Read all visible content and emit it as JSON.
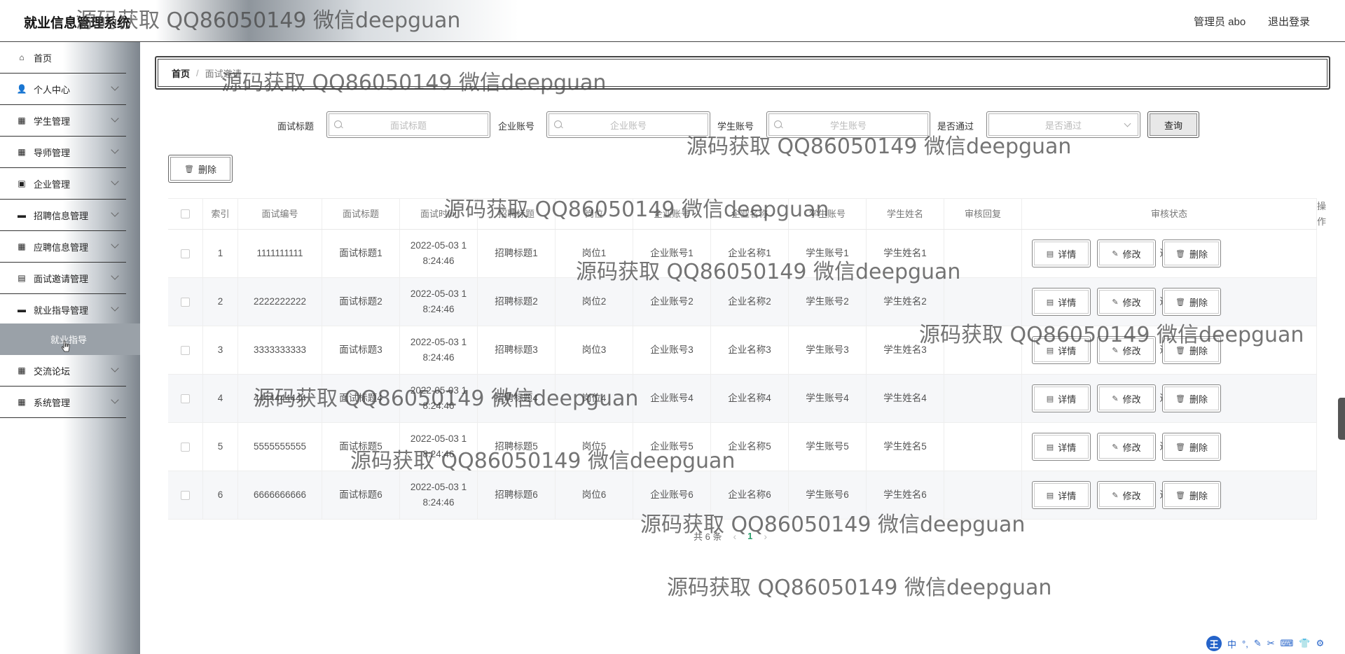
{
  "header": {
    "title": "就业信息管理系统",
    "user": "管理员 abo",
    "logout": "退出登录"
  },
  "sidebar": {
    "items": [
      {
        "label": "首页",
        "icon": "home-icon",
        "expandable": false
      },
      {
        "label": "个人中心",
        "icon": "user-icon",
        "expandable": true
      },
      {
        "label": "学生管理",
        "icon": "grid-icon",
        "expandable": true
      },
      {
        "label": "导师管理",
        "icon": "grid-icon",
        "expandable": true
      },
      {
        "label": "企业管理",
        "icon": "building-icon",
        "expandable": true
      },
      {
        "label": "招聘信息管理",
        "icon": "monitor-icon",
        "expandable": true
      },
      {
        "label": "应聘信息管理",
        "icon": "grid-icon",
        "expandable": true
      },
      {
        "label": "面试邀请管理",
        "icon": "chat-icon",
        "expandable": true
      },
      {
        "label": "就业指导管理",
        "icon": "monitor-icon",
        "expandable": true
      },
      {
        "label": "交流论坛",
        "icon": "grid-icon",
        "expandable": true
      },
      {
        "label": "系统管理",
        "icon": "grid-icon",
        "expandable": true
      }
    ],
    "active_sub": "就业指导"
  },
  "breadcrumb": {
    "home": "首页",
    "current": "面试邀请"
  },
  "search": {
    "title_label": "面试标题",
    "title_placeholder": "面试标题",
    "company_label": "企业账号",
    "company_placeholder": "企业账号",
    "student_label": "学生账号",
    "student_placeholder": "学生账号",
    "passed_label": "是否通过",
    "passed_placeholder": "是否通过",
    "query_button": "查询"
  },
  "toolbar": {
    "delete_button": "删除"
  },
  "table": {
    "columns": [
      "索引",
      "面试编号",
      "面试标题",
      "面试时间",
      "招聘标题",
      "岗位",
      "企业账号",
      "企业名称",
      "学生账号",
      "学生姓名",
      "审核回复",
      "审核状态",
      "操作"
    ],
    "rows": [
      {
        "index": "1",
        "code": "1111111111",
        "title": "面试标题1",
        "time": "2022-05-03 18:24:46",
        "job_title": "招聘标题1",
        "position": "岗位1",
        "company_account": "企业账号1",
        "company_name": "企业名称1",
        "student_account": "学生账号1",
        "student_name": "学生姓名1",
        "reply": "",
        "status": "通过"
      },
      {
        "index": "2",
        "code": "2222222222",
        "title": "面试标题2",
        "time": "2022-05-03 18:24:46",
        "job_title": "招聘标题2",
        "position": "岗位2",
        "company_account": "企业账号2",
        "company_name": "企业名称2",
        "student_account": "学生账号2",
        "student_name": "学生姓名2",
        "reply": "",
        "status": "通过"
      },
      {
        "index": "3",
        "code": "3333333333",
        "title": "面试标题3",
        "time": "2022-05-03 18:24:46",
        "job_title": "招聘标题3",
        "position": "岗位3",
        "company_account": "企业账号3",
        "company_name": "企业名称3",
        "student_account": "学生账号3",
        "student_name": "学生姓名3",
        "reply": "",
        "status": "通过"
      },
      {
        "index": "4",
        "code": "4444444444",
        "title": "面试标题4",
        "time": "2022-05-03 18:24:46",
        "job_title": "招聘标题4",
        "position": "岗位4",
        "company_account": "企业账号4",
        "company_name": "企业名称4",
        "student_account": "学生账号4",
        "student_name": "学生姓名4",
        "reply": "",
        "status": "通过"
      },
      {
        "index": "5",
        "code": "5555555555",
        "title": "面试标题5",
        "time": "2022-05-03 18:24:46",
        "job_title": "招聘标题5",
        "position": "岗位5",
        "company_account": "企业账号5",
        "company_name": "企业名称5",
        "student_account": "学生账号5",
        "student_name": "学生姓名5",
        "reply": "",
        "status": "通过"
      },
      {
        "index": "6",
        "code": "6666666666",
        "title": "面试标题6",
        "time": "2022-05-03 18:24:46",
        "job_title": "招聘标题6",
        "position": "岗位6",
        "company_account": "企业账号6",
        "company_name": "企业名称6",
        "student_account": "学生账号6",
        "student_name": "学生姓名6",
        "reply": "",
        "status": "通过"
      }
    ],
    "actions": {
      "detail": "详情",
      "edit": "修改",
      "delete": "删除"
    }
  },
  "pagination": {
    "total": "共 6 条",
    "current_page": "1"
  },
  "watermark": "源码获取 QQ86050149 微信deepguan",
  "ime": {
    "logo": "王",
    "mode": "中"
  },
  "colors": {
    "accent": "#2a9d6b",
    "sidebar_active": "#9aa1a8"
  }
}
